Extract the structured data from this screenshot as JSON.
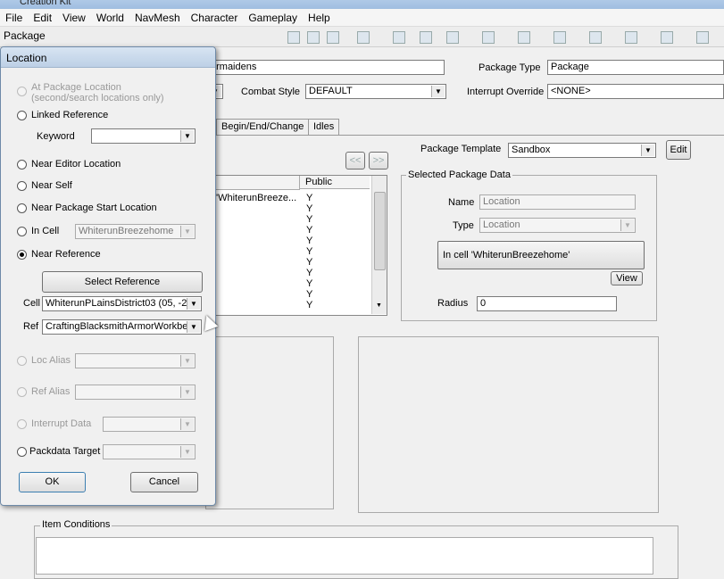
{
  "window": {
    "title": "Creation Kit"
  },
  "menu": [
    "File",
    "Edit",
    "View",
    "World",
    "NavMesh",
    "Character",
    "Gameplay",
    "Help"
  ],
  "package_window": {
    "title": "Package",
    "id_value": "armaidens",
    "package_type_label": "Package Type",
    "package_type_value": "Package",
    "combat_style_label": "Combat Style",
    "combat_style_value": "DEFAULT",
    "interrupt_override_label": "Interrupt Override",
    "interrupt_override_value": "<NONE>",
    "tabs": [
      "Begin/End/Change",
      "Idles"
    ],
    "package_template_label": "Package Template",
    "package_template_value": "Sandbox",
    "edit_button": "Edit",
    "nav_prev": "<<",
    "nav_next": ">>",
    "list_header_public": "Public",
    "list_first_row_text": "'WhiterunBreeze...",
    "list_public_values": [
      "Y",
      "Y",
      "Y",
      "Y",
      "Y",
      "Y",
      "Y",
      "Y",
      "Y",
      "Y",
      "Y"
    ],
    "selected_data": {
      "group_label": "Selected Package Data",
      "name_label": "Name",
      "name_value": "Location",
      "type_label": "Type",
      "type_value": "Location",
      "location_button": "In cell 'WhiterunBreezehome'",
      "view_button": "View",
      "radius_label": "Radius",
      "radius_value": "0"
    },
    "item_conditions_label": "Item Conditions"
  },
  "dialog": {
    "title": "Location",
    "opt_at_package_location": "At Package Location",
    "opt_at_package_location_sub": "(second/search locations only)",
    "opt_linked_reference": "Linked Reference",
    "keyword_label": "Keyword",
    "keyword_value": "",
    "opt_near_editor_location": "Near Editor Location",
    "opt_near_self": "Near Self",
    "opt_near_package_start": "Near Package Start Location",
    "opt_in_cell": "In Cell",
    "in_cell_value": "WhiterunBreezehome",
    "opt_near_reference": "Near Reference",
    "select_reference_button": "Select Reference",
    "cell_label": "Cell",
    "cell_value": "WhiterunPLainsDistrict03 (05, -2",
    "ref_label": "Ref",
    "ref_value": "CraftingBlacksmithArmorWorkben",
    "opt_loc_alias": "Loc Alias",
    "opt_ref_alias": "Ref Alias",
    "opt_interrupt_data": "Interrupt Data",
    "opt_packdata_target": "Packdata Target",
    "ok_button": "OK",
    "cancel_button": "Cancel"
  }
}
